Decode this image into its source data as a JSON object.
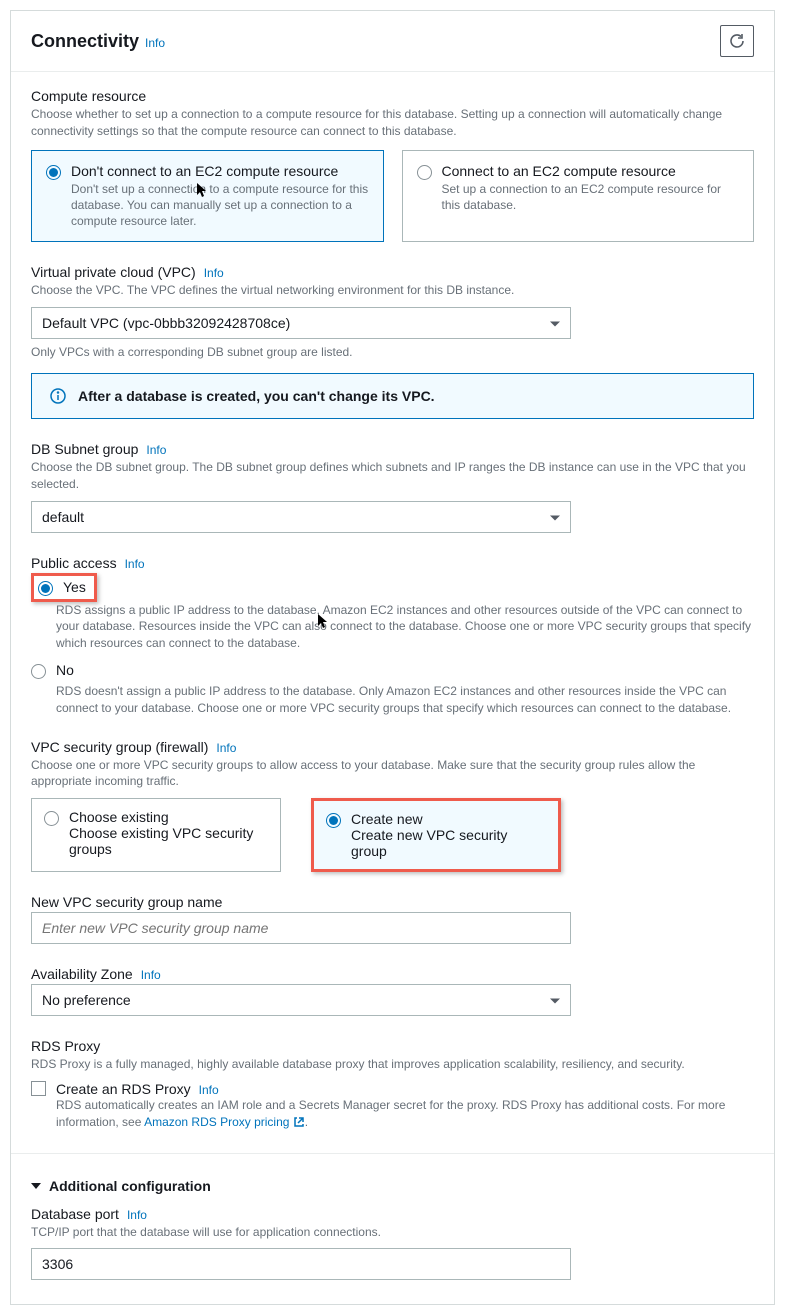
{
  "header": {
    "title": "Connectivity",
    "info": "Info"
  },
  "compute": {
    "label": "Compute resource",
    "helper": "Choose whether to set up a connection to a compute resource for this database. Setting up a connection will automatically change connectivity settings so that the compute resource can connect to this database.",
    "opt1_title": "Don't connect to an EC2 compute resource",
    "opt1_desc": "Don't set up a connection to a compute resource for this database. You can manually set up a connection to a compute resource later.",
    "opt2_title": "Connect to an EC2 compute resource",
    "opt2_desc": "Set up a connection to an EC2 compute resource for this database."
  },
  "vpc": {
    "label": "Virtual private cloud (VPC)",
    "info": "Info",
    "helper": "Choose the VPC. The VPC defines the virtual networking environment for this DB instance.",
    "value": "Default VPC (vpc-0bbb32092428708ce)",
    "note": "Only VPCs with a corresponding DB subnet group are listed.",
    "alert": "After a database is created, you can't change its VPC."
  },
  "subnet": {
    "label": "DB Subnet group",
    "info": "Info",
    "helper": "Choose the DB subnet group. The DB subnet group defines which subnets and IP ranges the DB instance can use in the VPC that you selected.",
    "value": "default"
  },
  "public": {
    "label": "Public access",
    "info": "Info",
    "yes": "Yes",
    "yes_desc": "RDS assigns a public IP address to the database. Amazon EC2 instances and other resources outside of the VPC can connect to your database. Resources inside the VPC can also connect to the database. Choose one or more VPC security groups that specify which resources can connect to the database.",
    "no": "No",
    "no_desc": "RDS doesn't assign a public IP address to the database. Only Amazon EC2 instances and other resources inside the VPC can connect to your database. Choose one or more VPC security groups that specify which resources can connect to the database."
  },
  "sg": {
    "label": "VPC security group (firewall)",
    "info": "Info",
    "helper": "Choose one or more VPC security groups to allow access to your database. Make sure that the security group rules allow the appropriate incoming traffic.",
    "opt1_title": "Choose existing",
    "opt1_desc": "Choose existing VPC security groups",
    "opt2_title": "Create new",
    "opt2_desc": "Create new VPC security group"
  },
  "sg_name": {
    "label": "New VPC security group name",
    "placeholder": "Enter new VPC security group name"
  },
  "az": {
    "label": "Availability Zone",
    "info": "Info",
    "value": "No preference"
  },
  "proxy": {
    "label": "RDS Proxy",
    "helper": "RDS Proxy is a fully managed, highly available database proxy that improves application scalability, resiliency, and security.",
    "checkbox": "Create an RDS Proxy",
    "info": "Info",
    "desc_prefix": "RDS automatically creates an IAM role and a Secrets Manager secret for the proxy. RDS Proxy has additional costs. For more information, see ",
    "link": "Amazon RDS Proxy pricing",
    "desc_suffix": "."
  },
  "additional": {
    "label": "Additional configuration"
  },
  "port": {
    "label": "Database port",
    "info": "Info",
    "helper": "TCP/IP port that the database will use for application connections.",
    "value": "3306"
  }
}
